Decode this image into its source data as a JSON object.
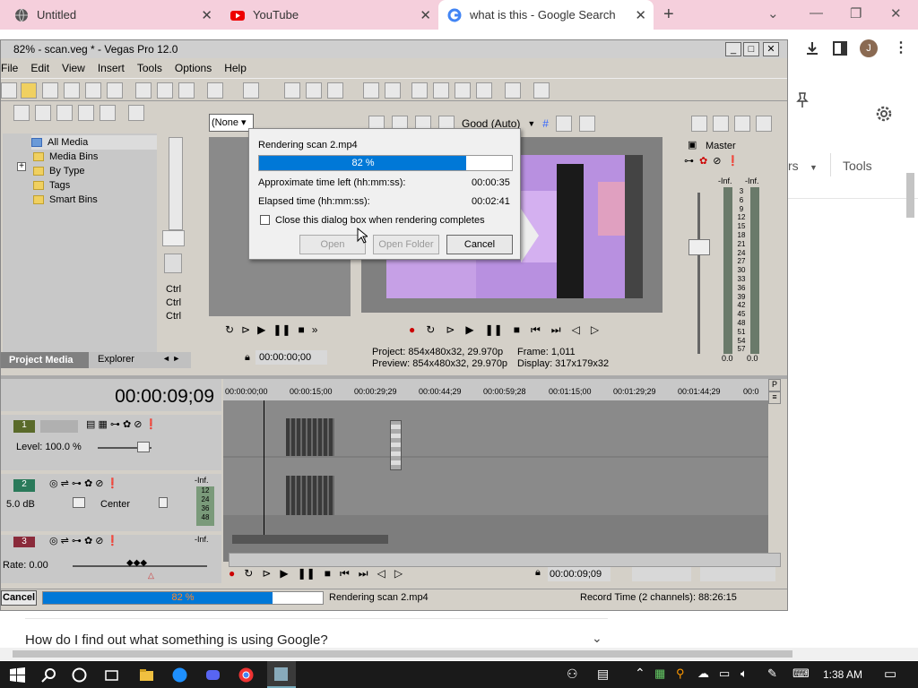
{
  "browser": {
    "tabs": [
      {
        "label": "Untitled"
      },
      {
        "label": "YouTube"
      },
      {
        "label": "what is this - Google Search"
      }
    ],
    "new_tab": "+",
    "avatar": "J",
    "right_tools": "Tools",
    "right_rs": "rs",
    "search_result_question": "How do I find out what something is using Google?"
  },
  "vegas": {
    "title": "82% - scan.veg * - Vegas Pro 12.0",
    "menu": [
      "File",
      "Edit",
      "View",
      "Insert",
      "Tools",
      "Options",
      "Help"
    ],
    "media_tree": [
      "All Media",
      "Media Bins",
      "By Type",
      "Tags",
      "Smart Bins"
    ],
    "trimmer_select": "(None",
    "preview_quality": "Good (Auto)",
    "master_label": "Master",
    "meter_inf": [
      "-Inf.",
      "-Inf."
    ],
    "meter_scale": [
      "3",
      "6",
      "9",
      "12",
      "15",
      "18",
      "21",
      "24",
      "27",
      "30",
      "33",
      "36",
      "39",
      "42",
      "45",
      "48",
      "51",
      "54",
      "57"
    ],
    "meter_bottom": [
      "0.0",
      "0.0"
    ],
    "ctrl_labels": [
      "Ctrl",
      "Ctrl",
      "Ctrl"
    ],
    "tabs": {
      "project_media": "Project Media",
      "explorer": "Explorer"
    },
    "trimmer_time": "00:00:00;00",
    "project_info": "Project:  854x480x32, 29.970p",
    "preview_info": "Preview:  854x480x32, 29.970p",
    "frame_info": "Frame:     1,011",
    "display_info": "Display:   317x179x32",
    "timecode": "00:00:09;09",
    "ruler": [
      "00:00:00;00",
      "00:00:15;00",
      "00:00:29;29",
      "00:00:44;29",
      "00:00:59;28",
      "00:01:15;00",
      "00:01:29;29",
      "00:01:44;29",
      "00:0"
    ],
    "track1": {
      "num": "1",
      "level": "Level: 100.0 %"
    },
    "track2": {
      "num": "2",
      "vol": "5.0 dB",
      "pan": "Center",
      "inf": "-Inf.",
      "scale": [
        "12",
        "24",
        "36",
        "48"
      ]
    },
    "track3": {
      "num": "3",
      "inf": "-Inf."
    },
    "rate": "Rate: 0.00",
    "bottom_time": "00:00:09;09",
    "status": {
      "cancel": "Cancel",
      "progress_text": "82 %",
      "progress": 82,
      "rendering": "Rendering scan 2.mp4",
      "record_time": "Record Time (2 channels): 88:26:15"
    }
  },
  "dialog": {
    "title": "Rendering scan 2.mp4",
    "progress_text": "82 %",
    "progress": 82,
    "approx_label": "Approximate time left (hh:mm:ss):",
    "approx_value": "00:00:35",
    "elapsed_label": "Elapsed time (hh:mm:ss):",
    "elapsed_value": "00:02:41",
    "checkbox_label": "Close this dialog box when rendering completes",
    "buttons": {
      "open": "Open",
      "open_folder": "Open Folder",
      "cancel": "Cancel"
    }
  },
  "taskbar": {
    "time": "1:38 AM"
  },
  "colors": {
    "accent": "#0078d7",
    "tabbar": "#f5cfdc",
    "vegas_bg": "#d4d0c8"
  }
}
